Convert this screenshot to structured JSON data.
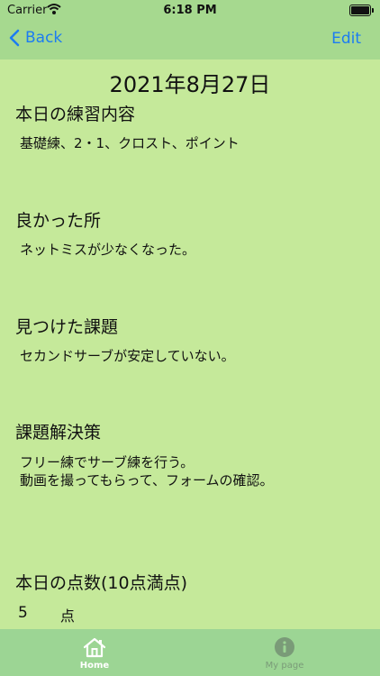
{
  "status_bar": {
    "carrier": "Carrier",
    "time": "6:18 PM"
  },
  "nav": {
    "back_label": "Back",
    "edit_label": "Edit"
  },
  "date": "2021年8月27日",
  "sections": [
    {
      "heading": "本日の練習内容",
      "body": "基礎練、2・1、クロスト、ポイント"
    },
    {
      "heading": "良かった所",
      "body": "ネットミスが少なくなった。"
    },
    {
      "heading": "見つけた課題",
      "body": "セカンドサーブが安定していない。"
    },
    {
      "heading": "課題解決策",
      "body": "フリー練でサーブ練を行う。\n動画を撮ってもらって、フォームの確認。"
    },
    {
      "heading": "本日の点数(10点満点)",
      "body": ""
    }
  ],
  "score": {
    "value": "5",
    "unit": "点"
  },
  "tabs": [
    {
      "label": "Home",
      "icon": "home-icon",
      "selected": true
    },
    {
      "label": "My page",
      "icon": "info-icon",
      "selected": false
    }
  ],
  "colors": {
    "background": "#c5e99a",
    "nav_bar": "#a6d98f",
    "tab_bar": "#9cd594",
    "accent": "#1c7cf2"
  }
}
